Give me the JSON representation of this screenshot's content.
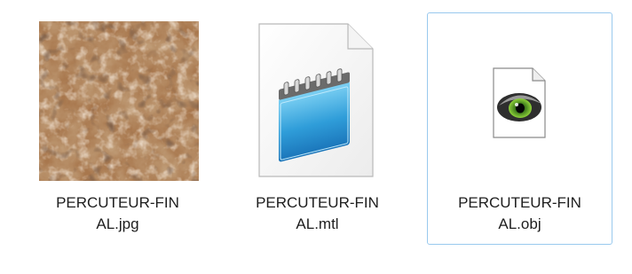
{
  "view": {
    "selection_border_color": "#99c9ee",
    "label_color": "#1e1e1e"
  },
  "files": [
    {
      "name_line1": "PERCUTEUR-FIN",
      "name_line2": "AL.jpg",
      "thumbnail": "texture-image-thumbnail",
      "selected": false
    },
    {
      "name_line1": "PERCUTEUR-FIN",
      "name_line2": "AL.mtl",
      "thumbnail": "notepad-document-icon",
      "selected": false
    },
    {
      "name_line1": "PERCUTEUR-FIN",
      "name_line2": "AL.obj",
      "thumbnail": "eye-app-document-icon",
      "selected": true
    }
  ]
}
